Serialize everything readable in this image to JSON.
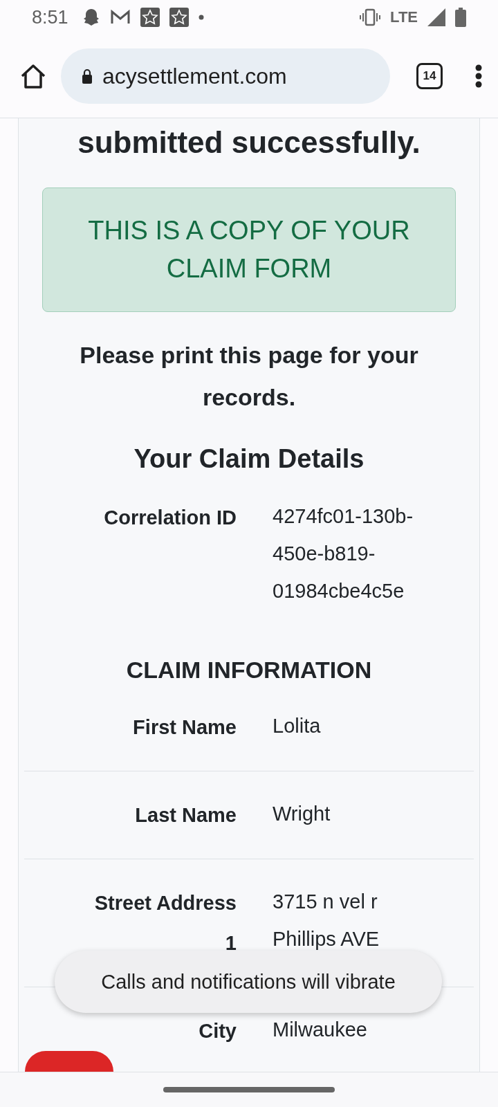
{
  "status_bar": {
    "time": "8:51",
    "network": "LTE"
  },
  "browser": {
    "url": "acysettlement.com",
    "tab_count": "14"
  },
  "page": {
    "heading": "submitted successfully.",
    "alert": "THIS IS A COPY OF YOUR CLAIM FORM",
    "instruction": "Please print this page for your records.",
    "details_title": "Your Claim Details",
    "summary": [
      {
        "label": "Correlation ID",
        "value": "4274fc01-130b-450e-b819-01984cbe4c5e"
      }
    ],
    "section_title": "CLAIM INFORMATION",
    "fields": [
      {
        "label": "First Name",
        "value": "Lolita"
      },
      {
        "label": "Last Name",
        "value": "Wright"
      },
      {
        "label": "Street Address 1",
        "value": "3715 n vel r Phillips AVE"
      },
      {
        "label": "City",
        "value": "Milwaukee"
      }
    ]
  },
  "toast": "Calls and notifications will vibrate"
}
